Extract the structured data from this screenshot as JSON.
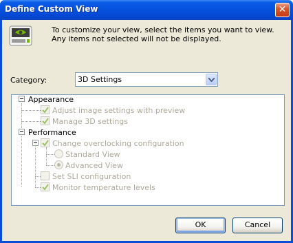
{
  "window": {
    "title": "Define Custom View"
  },
  "intro_text": "To customize your view, select the items you want to view. Any items not selected will not be displayed.",
  "category": {
    "label": "Category:",
    "selected": "3D Settings"
  },
  "tree": {
    "groups": [
      {
        "label": "Appearance",
        "expanded": true,
        "items": [
          {
            "label": "Adjust image settings with preview",
            "checked": true
          },
          {
            "label": "Manage 3D settings",
            "checked": true
          }
        ]
      },
      {
        "label": "Performance",
        "expanded": true,
        "items": [
          {
            "label": "Change overclocking configuration",
            "checked": true,
            "expanded": true,
            "options": [
              {
                "label": "Standard View",
                "selected": false
              },
              {
                "label": "Advanced View",
                "selected": true
              }
            ]
          },
          {
            "label": "Set SLI configuration",
            "checked": false
          },
          {
            "label": "Monitor temperature levels",
            "checked": true
          }
        ]
      }
    ]
  },
  "buttons": {
    "ok": "OK",
    "cancel": "Cancel"
  },
  "colors": {
    "title_bar": "#0653e0",
    "dialog_bg": "#ece9d8",
    "nvidia_green": "#76b900",
    "disabled_text": "#aca899"
  }
}
